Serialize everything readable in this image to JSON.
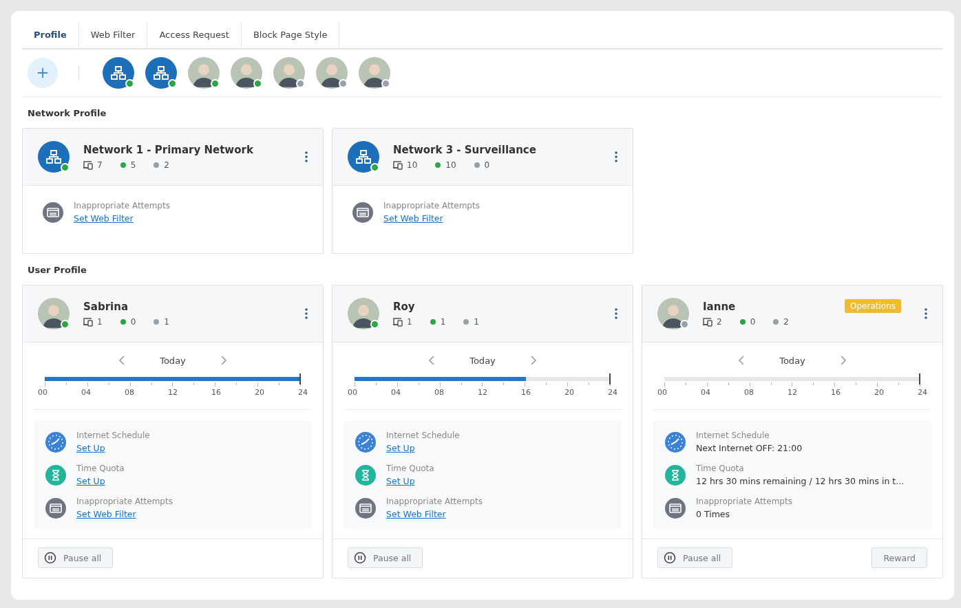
{
  "tabs": [
    {
      "label": "Profile",
      "selected": true
    },
    {
      "label": "Web Filter",
      "selected": false
    },
    {
      "label": "Access Request",
      "selected": false
    },
    {
      "label": "Block Page Style",
      "selected": false
    }
  ],
  "avatar_bar": [
    {
      "kind": "network",
      "online": true
    },
    {
      "kind": "network",
      "online": true
    },
    {
      "kind": "person",
      "online": true
    },
    {
      "kind": "person",
      "online": true
    },
    {
      "kind": "person",
      "online": false
    },
    {
      "kind": "person",
      "online": false
    },
    {
      "kind": "person",
      "online": false
    }
  ],
  "network_profile": {
    "heading": "Network Profile",
    "cards": [
      {
        "name": "Network 1 - Primary Network",
        "online": true,
        "devices": "7",
        "online_count": "5",
        "offline_count": "2",
        "label": "Inappropriate Attempts",
        "link": "Set Web Filter"
      },
      {
        "name": "Network 3 - Surveillance",
        "online": true,
        "devices": "10",
        "online_count": "10",
        "offline_count": "0",
        "label": "Inappropriate Attempts",
        "link": "Set Web Filter"
      }
    ]
  },
  "user_profile": {
    "heading": "User Profile",
    "cards": [
      {
        "name": "Sabrina",
        "online": true,
        "devices": "1",
        "online_count": "0",
        "offline_count": "1",
        "day": "Today",
        "level": 1,
        "hours": [
          "00",
          "04",
          "08",
          "12",
          "16",
          "20",
          "24"
        ],
        "items": [
          {
            "kind": "schedule",
            "label": "Internet Schedule",
            "value": "Set Up",
            "link": true
          },
          {
            "kind": "quota",
            "label": "Time Quota",
            "value": "Set Up",
            "link": true
          },
          {
            "kind": "attempts",
            "label": "Inappropriate Attempts",
            "value": "Set Web Filter",
            "link": true
          }
        ],
        "buttons": [
          {
            "kind": "pause",
            "label": "Pause all"
          }
        ]
      },
      {
        "name": "Roy",
        "online": true,
        "devices": "1",
        "online_count": "1",
        "offline_count": "1",
        "day": "Today",
        "level": 0.67,
        "hours": [
          "00",
          "04",
          "08",
          "12",
          "16",
          "20",
          "24"
        ],
        "items": [
          {
            "kind": "schedule",
            "label": "Internet Schedule",
            "value": "Set Up",
            "link": true
          },
          {
            "kind": "quota",
            "label": "Time Quota",
            "value": "Set Up",
            "link": true
          },
          {
            "kind": "attempts",
            "label": "Inappropriate Attempts",
            "value": "Set Web Filter",
            "link": true
          }
        ],
        "buttons": [
          {
            "kind": "pause",
            "label": "Pause all"
          }
        ]
      },
      {
        "name": "Ianne",
        "online": false,
        "badge": "Operations",
        "devices": "2",
        "online_count": "0",
        "offline_count": "2",
        "day": "Today",
        "level": 0,
        "hours": [
          "00",
          "04",
          "08",
          "12",
          "16",
          "20",
          "24"
        ],
        "items": [
          {
            "kind": "schedule",
            "label": "Internet Schedule",
            "value": "Next Internet OFF: 21:00",
            "link": false
          },
          {
            "kind": "quota",
            "label": "Time Quota",
            "value": "12 hrs 30 mins remaining / 12 hrs 30 mins in t...",
            "link": false
          },
          {
            "kind": "attempts",
            "label": "Inappropriate Attempts",
            "value": "0 Times",
            "link": false
          }
        ],
        "buttons": [
          {
            "kind": "pause",
            "label": "Pause all"
          },
          {
            "kind": "plain",
            "label": "Reward"
          }
        ]
      }
    ]
  }
}
